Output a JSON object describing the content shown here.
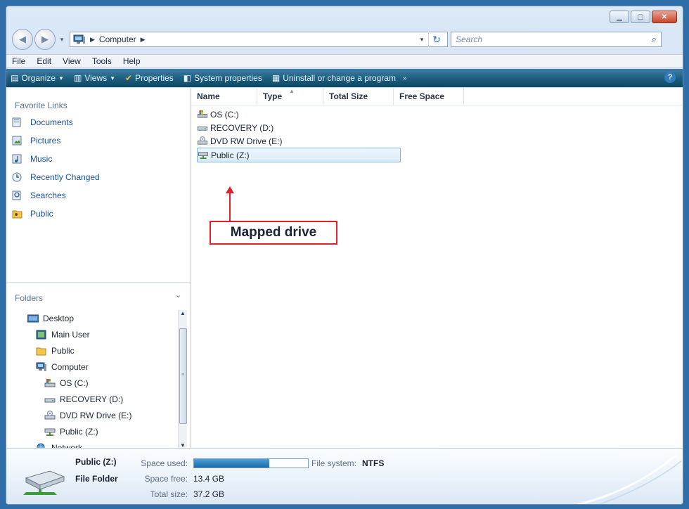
{
  "window": {
    "caption_buttons": [
      "minimize",
      "maximize",
      "close"
    ]
  },
  "address_bar": {
    "location": "Computer",
    "search_placeholder": "Search"
  },
  "menu": [
    "File",
    "Edit",
    "View",
    "Tools",
    "Help"
  ],
  "command_bar": {
    "organize": "Organize",
    "views": "Views",
    "properties": "Properties",
    "system_properties": "System properties",
    "uninstall": "Uninstall or change a program",
    "more": "»"
  },
  "favorite_links": {
    "title": "Favorite Links",
    "items": [
      "Documents",
      "Pictures",
      "Music",
      "Recently Changed",
      "Searches",
      "Public"
    ]
  },
  "folders": {
    "title": "Folders",
    "tree": [
      {
        "label": "Desktop",
        "icon": "desktop-icon",
        "level": 0
      },
      {
        "label": "Main User",
        "icon": "user-folder-icon",
        "level": 1
      },
      {
        "label": "Public",
        "icon": "folder-icon",
        "level": 1
      },
      {
        "label": "Computer",
        "icon": "computer-icon",
        "level": 1
      },
      {
        "label": "OS (C:)",
        "icon": "os-drive-icon",
        "level": 2
      },
      {
        "label": "RECOVERY (D:)",
        "icon": "hard-drive-icon",
        "level": 2
      },
      {
        "label": "DVD RW Drive (E:)",
        "icon": "dvd-drive-icon",
        "level": 2
      },
      {
        "label": "Public (Z:)",
        "icon": "network-drive-icon",
        "level": 2
      },
      {
        "label": "Network",
        "icon": "network-icon",
        "level": 1
      }
    ]
  },
  "columns": [
    "Name",
    "Type",
    "Total Size",
    "Free Space"
  ],
  "files": [
    {
      "label": "OS (C:)",
      "icon": "os-drive-icon"
    },
    {
      "label": "RECOVERY (D:)",
      "icon": "hard-drive-icon"
    },
    {
      "label": "DVD RW Drive (E:)",
      "icon": "dvd-drive-icon"
    },
    {
      "label": "Public (Z:)",
      "icon": "network-drive-icon",
      "selected": true
    }
  ],
  "annotation": "Mapped drive",
  "details": {
    "name": "Public (Z:)",
    "type": "File Folder",
    "space_used_label": "Space used:",
    "space_used_fraction": 0.66,
    "space_free_label": "Space free:",
    "space_free_value": "13.4 GB",
    "total_size_label": "Total size:",
    "total_size_value": "37.2 GB",
    "file_system_label": "File system:",
    "file_system_value": "NTFS"
  },
  "colors": {
    "frame": "#2f6ea8",
    "command_bar": "#1b5d7d",
    "link": "#1b4f9b",
    "annotation": "#e0202a",
    "usage_fill": "#1a6cab"
  }
}
